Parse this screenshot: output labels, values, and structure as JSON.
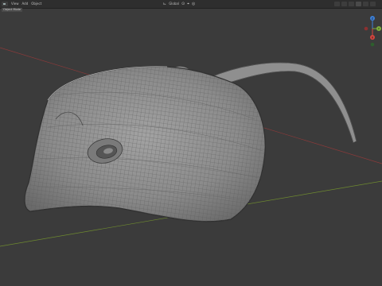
{
  "header": {
    "menu": [
      "View",
      "Add",
      "Object"
    ],
    "orientation_label": "Global"
  },
  "mode_tab": "Object Mode",
  "axis_colors": {
    "x": "#8a3a3a",
    "y": "#6e8a2f",
    "z": "#2f5f9e"
  },
  "gizmo": {
    "labels": [
      "Z",
      "Y",
      "X"
    ]
  },
  "viewport": {
    "background": "#3b3b3b",
    "grid_line": "#353535"
  }
}
